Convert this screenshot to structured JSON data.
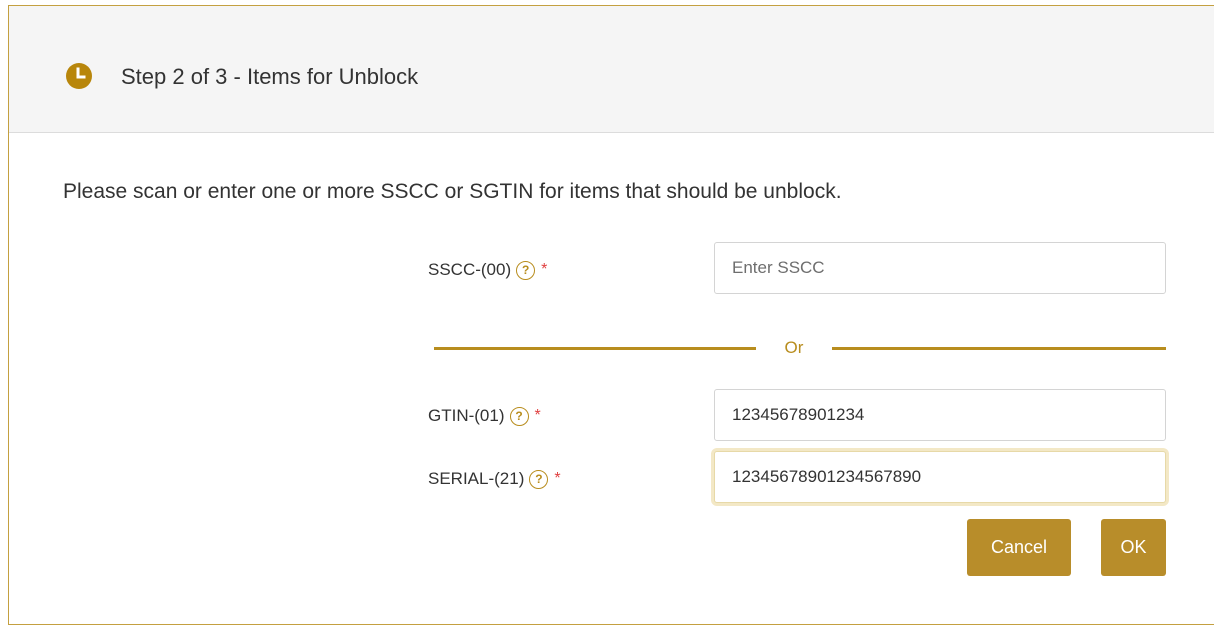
{
  "header": {
    "title": "Step 2 of 3 - Items for Unblock",
    "icon": "clock-icon"
  },
  "instructions": "Please scan or enter one or more SSCC or SGTIN for items that should be unblock.",
  "fields": {
    "sscc": {
      "label": "SSCC-(00)",
      "help": "?",
      "required": "*",
      "value": "",
      "placeholder": "Enter SSCC"
    },
    "gtin": {
      "label": "GTIN-(01)",
      "help": "?",
      "required": "*",
      "value": "12345678901234",
      "placeholder": ""
    },
    "serial": {
      "label": "SERIAL-(21)",
      "help": "?",
      "required": "*",
      "value": "12345678901234567890",
      "placeholder": ""
    }
  },
  "divider": {
    "text": "Or"
  },
  "buttons": {
    "cancel": "Cancel",
    "ok": "OK"
  },
  "colors": {
    "accent": "#b88d2a",
    "required": "#e04040",
    "header_bg": "#f5f5f5"
  }
}
